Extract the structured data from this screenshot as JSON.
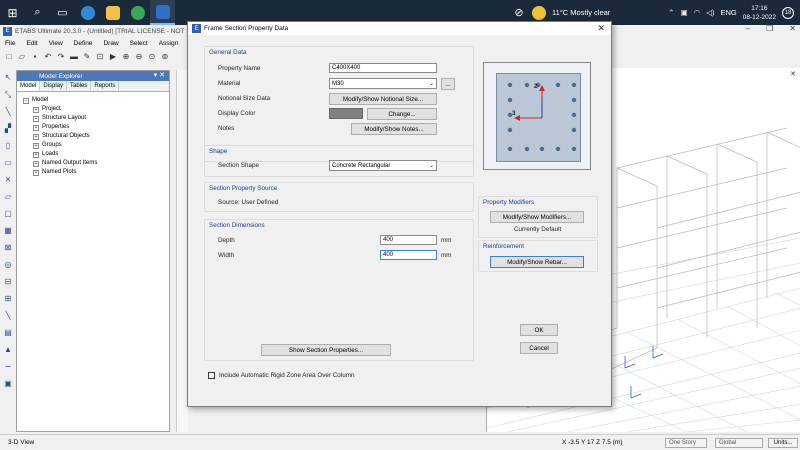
{
  "taskbar": {
    "weather": "11°C  Mostly clear",
    "language": "ENG",
    "time": "17:16",
    "date": "08-12-2022",
    "notifications": "18"
  },
  "app": {
    "title": "ETABS Ultimate 20.3.0 - (Untitled)  [TRIAL LICENSE - NOT",
    "menu": [
      "File",
      "Edit",
      "View",
      "Define",
      "Draw",
      "Select",
      "Assign"
    ]
  },
  "explorer": {
    "title": "Model Explorer",
    "tabs": [
      "Model",
      "Display",
      "Tables",
      "Reports"
    ],
    "root": "Model",
    "items": [
      "Project",
      "Structure Layout",
      "Properties",
      "Structural Objects",
      "Groups",
      "Loads",
      "Named Output Items",
      "Named Plots"
    ]
  },
  "dialog": {
    "title": "Frame Section Property Data",
    "general_data": {
      "heading": "General Data",
      "property_name_label": "Property Name",
      "property_name_value": "C400X400",
      "material_label": "Material",
      "material_value": "M30",
      "material_more": "...",
      "notional_label": "Notional Size Data",
      "notional_button": "Modify/Show Notional Size...",
      "color_label": "Display Color",
      "color_button": "Change...",
      "color_value": "#808080",
      "notes_label": "Notes",
      "notes_button": "Modify/Show Notes..."
    },
    "shape": {
      "heading": "Shape",
      "label": "Section Shape",
      "value": "Concrete Rectangular"
    },
    "source": {
      "heading": "Section Property Source",
      "text": "Source:  User Defined"
    },
    "dimensions": {
      "heading": "Section Dimensions",
      "depth_label": "Depth",
      "depth_value": "400",
      "width_label": "Width",
      "width_value": "400",
      "unit": "mm"
    },
    "show_properties_button": "Show Section Properties...",
    "rigid_zone_label": "Include Automatic Rigid Zone Area Over Column",
    "preview_axis_2": "2",
    "preview_axis_3": "3",
    "modifiers": {
      "heading": "Property Modifiers",
      "button": "Modify/Show Modifiers...",
      "status": "Currently Default"
    },
    "reinforcement": {
      "heading": "Reinforcement",
      "button": "Modify/Show Rebar..."
    },
    "ok_button": "OK",
    "cancel_button": "Cancel"
  },
  "status": {
    "view": "3-D View",
    "coords": "X -3.5  Y 17  Z 7.5 (m)",
    "story": "One Story",
    "coord_system": "Global",
    "units_button": "Units..."
  }
}
